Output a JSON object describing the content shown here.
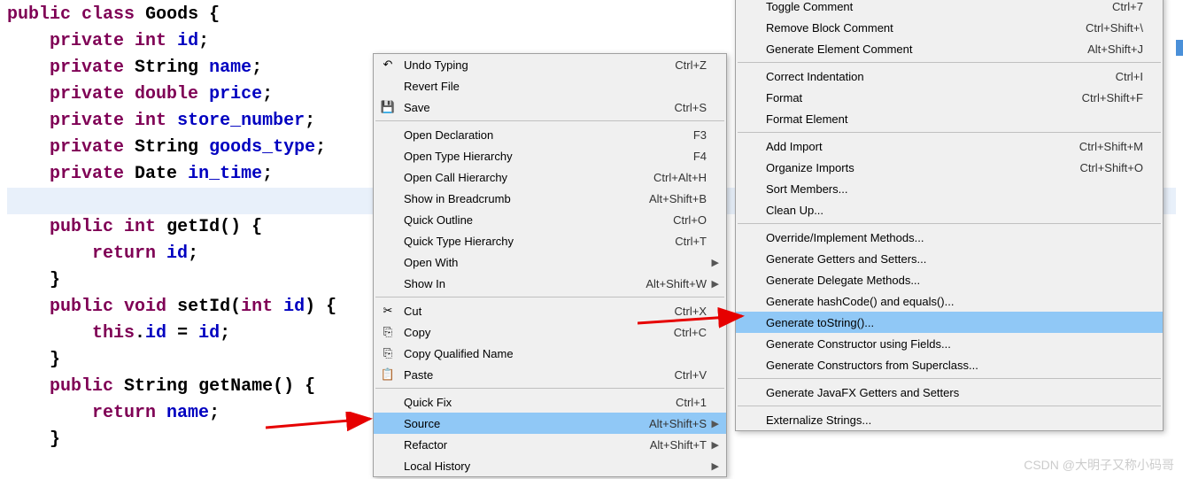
{
  "code": {
    "lines": [
      {
        "html": "<span class='kw'>public</span> <span class='kw'>class</span> <span class='type'>Goods</span> <span class='plain'>{</span>"
      },
      {
        "html": "    <span class='kw'>private</span> <span class='kw'>int</span> <span class='var'>id</span><span class='plain'>;</span>"
      },
      {
        "html": "    <span class='kw'>private</span> <span class='type'>String</span> <span class='var'>name</span><span class='plain'>;</span>"
      },
      {
        "html": "    <span class='kw'>private</span> <span class='kw'>double</span> <span class='var'>price</span><span class='plain'>;</span>"
      },
      {
        "html": "    <span class='kw'>private</span> <span class='kw'>int</span> <span class='var'>store_number</span><span class='plain'>;</span>"
      },
      {
        "html": "    <span class='kw'>private</span> <span class='type'>String</span> <span class='var'>goods_type</span><span class='plain'>;</span>"
      },
      {
        "html": "    <span class='kw'>private</span> <span class='type'>Date</span> <span class='var'>in_time</span><span class='plain'>;</span>"
      },
      {
        "html": "    ",
        "highlight": true
      },
      {
        "html": "    <span class='kw'>public</span> <span class='kw'>int</span> <span class='plain'>getId() {</span>"
      },
      {
        "html": "        <span class='kw'>return</span> <span class='var'>id</span><span class='plain'>;</span>"
      },
      {
        "html": "    <span class='plain'>}</span>"
      },
      {
        "html": "    <span class='kw'>public</span> <span class='kw'>void</span> <span class='plain'>setId(</span><span class='kw'>int</span> <span class='var'>id</span><span class='plain'>) {</span>"
      },
      {
        "html": "        <span class='kw'>this</span><span class='plain'>.</span><span class='var'>id</span> <span class='plain'>=</span> <span class='var'>id</span><span class='plain'>;</span>"
      },
      {
        "html": "    <span class='plain'>}</span>"
      },
      {
        "html": "    <span class='kw'>public</span> <span class='type'>String</span> <span class='plain'>getName() {</span>"
      },
      {
        "html": "        <span class='kw'>return</span> <span class='var'>name</span><span class='plain'>;</span>"
      },
      {
        "html": "    <span class='plain'>}</span>"
      }
    ]
  },
  "contextMenu": {
    "items": [
      {
        "type": "row",
        "icon": "↶",
        "label": "Undo Typing",
        "shortcut": "Ctrl+Z"
      },
      {
        "type": "row",
        "label": "Revert File"
      },
      {
        "type": "row",
        "icon": "💾",
        "label": "Save",
        "shortcut": "Ctrl+S"
      },
      {
        "type": "sep"
      },
      {
        "type": "row",
        "label": "Open Declaration",
        "shortcut": "F3"
      },
      {
        "type": "row",
        "label": "Open Type Hierarchy",
        "shortcut": "F4"
      },
      {
        "type": "row",
        "label": "Open Call Hierarchy",
        "shortcut": "Ctrl+Alt+H"
      },
      {
        "type": "row",
        "label": "Show in Breadcrumb",
        "shortcut": "Alt+Shift+B"
      },
      {
        "type": "row",
        "label": "Quick Outline",
        "shortcut": "Ctrl+O"
      },
      {
        "type": "row",
        "label": "Quick Type Hierarchy",
        "shortcut": "Ctrl+T"
      },
      {
        "type": "row",
        "label": "Open With",
        "sub": true
      },
      {
        "type": "row",
        "label": "Show In",
        "shortcut": "Alt+Shift+W",
        "sub": true
      },
      {
        "type": "sep"
      },
      {
        "type": "row",
        "icon": "✂",
        "label": "Cut",
        "shortcut": "Ctrl+X"
      },
      {
        "type": "row",
        "icon": "⎘",
        "label": "Copy",
        "shortcut": "Ctrl+C"
      },
      {
        "type": "row",
        "icon": "⎘",
        "label": "Copy Qualified Name"
      },
      {
        "type": "row",
        "icon": "📋",
        "label": "Paste",
        "shortcut": "Ctrl+V"
      },
      {
        "type": "sep"
      },
      {
        "type": "row",
        "label": "Quick Fix",
        "shortcut": "Ctrl+1"
      },
      {
        "type": "row",
        "label": "Source",
        "shortcut": "Alt+Shift+S",
        "sub": true,
        "hover": true
      },
      {
        "type": "row",
        "label": "Refactor",
        "shortcut": "Alt+Shift+T",
        "sub": true
      },
      {
        "type": "row",
        "label": "Local History",
        "sub": true
      }
    ]
  },
  "sourceSubmenu": {
    "items": [
      {
        "type": "row",
        "label": "Toggle Comment",
        "shortcut": "Ctrl+7"
      },
      {
        "type": "row",
        "label": "Remove Block Comment",
        "shortcut": "Ctrl+Shift+\\"
      },
      {
        "type": "row",
        "label": "Generate Element Comment",
        "shortcut": "Alt+Shift+J"
      },
      {
        "type": "sep"
      },
      {
        "type": "row",
        "label": "Correct Indentation",
        "shortcut": "Ctrl+I"
      },
      {
        "type": "row",
        "label": "Format",
        "shortcut": "Ctrl+Shift+F"
      },
      {
        "type": "row",
        "label": "Format Element"
      },
      {
        "type": "sep"
      },
      {
        "type": "row",
        "label": "Add Import",
        "shortcut": "Ctrl+Shift+M"
      },
      {
        "type": "row",
        "label": "Organize Imports",
        "shortcut": "Ctrl+Shift+O"
      },
      {
        "type": "row",
        "label": "Sort Members..."
      },
      {
        "type": "row",
        "label": "Clean Up..."
      },
      {
        "type": "sep"
      },
      {
        "type": "row",
        "label": "Override/Implement Methods..."
      },
      {
        "type": "row",
        "label": "Generate Getters and Setters..."
      },
      {
        "type": "row",
        "label": "Generate Delegate Methods..."
      },
      {
        "type": "row",
        "label": "Generate hashCode() and equals()..."
      },
      {
        "type": "row",
        "label": "Generate toString()...",
        "hover": true
      },
      {
        "type": "row",
        "label": "Generate Constructor using Fields..."
      },
      {
        "type": "row",
        "label": "Generate Constructors from Superclass..."
      },
      {
        "type": "sep"
      },
      {
        "type": "row",
        "label": "Generate JavaFX Getters and Setters"
      },
      {
        "type": "sep"
      },
      {
        "type": "row",
        "label": "Externalize Strings..."
      }
    ]
  },
  "watermark": "CSDN @大明子又称小码哥"
}
